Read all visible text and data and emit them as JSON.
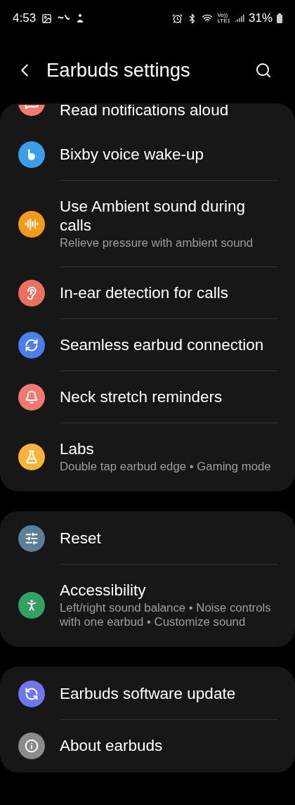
{
  "status_bar": {
    "time": "4:53",
    "network_top": "Vo))",
    "network_bottom": "LTE1",
    "battery": "31%"
  },
  "header": {
    "title": "Earbuds settings"
  },
  "groups": [
    {
      "items": [
        {
          "title": "Read notifications aloud",
          "color": "#f47b6b",
          "kind": "partial"
        },
        {
          "title": "Bixby voice wake-up",
          "color": "#3d9de8",
          "kind": "row"
        },
        {
          "title": "Use Ambient sound during calls",
          "subtitle": "Relieve pressure with ambient sound",
          "color": "#f19a1c",
          "kind": "row"
        },
        {
          "title": "In-ear detection for calls",
          "color": "#ec6f62",
          "kind": "row"
        },
        {
          "title": "Seamless earbud connection",
          "color": "#4b7ee8",
          "kind": "row"
        },
        {
          "title": "Neck stretch reminders",
          "color": "#f07a72",
          "kind": "row"
        },
        {
          "title": "Labs",
          "subtitle": "Double tap earbud edge  •  Gaming mode",
          "color": "#f8b43a",
          "kind": "row"
        }
      ]
    },
    {
      "items": [
        {
          "title": "Reset",
          "color": "#5b7f99",
          "kind": "row"
        },
        {
          "title": "Accessibility",
          "subtitle": "Left/right sound balance  •  Noise controls with one earbud  •  Customize sound",
          "color": "#33a163",
          "kind": "row"
        }
      ]
    },
    {
      "items": [
        {
          "title": "Earbuds software update",
          "color": "#6f78ea",
          "kind": "row"
        },
        {
          "title": "About earbuds",
          "color": "#8b8b8b",
          "kind": "row"
        }
      ]
    }
  ]
}
